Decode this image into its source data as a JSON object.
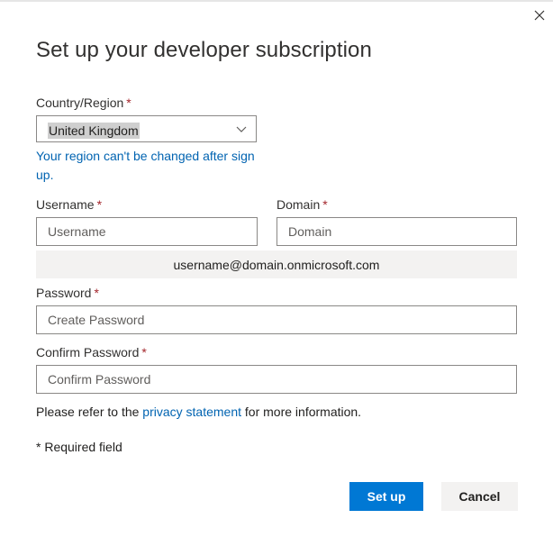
{
  "dialog": {
    "title": "Set up your developer subscription",
    "close_icon": "close-icon"
  },
  "country": {
    "label": "Country/Region",
    "required_mark": "*",
    "selected": "United Kingdom",
    "chevron_icon": "chevron-down-icon",
    "note": "Your region can't be changed after sign up."
  },
  "username": {
    "label": "Username",
    "required_mark": "*",
    "placeholder": "Username",
    "value": ""
  },
  "domain": {
    "label": "Domain",
    "required_mark": "*",
    "placeholder": "Domain",
    "value": ""
  },
  "preview": {
    "text": "username@domain.onmicrosoft.com"
  },
  "password": {
    "label": "Password",
    "required_mark": "*",
    "placeholder": "Create Password",
    "value": ""
  },
  "confirm_password": {
    "label": "Confirm Password",
    "required_mark": "*",
    "placeholder": "Confirm Password",
    "value": ""
  },
  "privacy": {
    "prefix": "Please refer to the ",
    "link": "privacy statement",
    "suffix": " for more information."
  },
  "required_note": "* Required field",
  "buttons": {
    "setup": "Set up",
    "cancel": "Cancel"
  },
  "colors": {
    "accent": "#0078d4",
    "link": "#0063b1",
    "required": "#a4262c"
  }
}
